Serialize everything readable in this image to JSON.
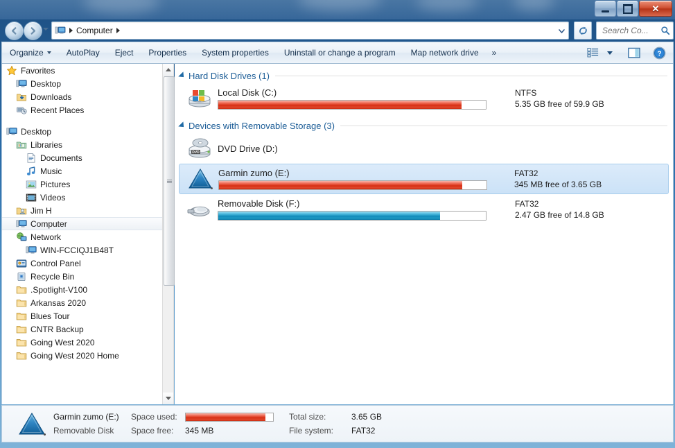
{
  "window": {
    "minimize_label": "Minimize",
    "maximize_label": "Maximize",
    "close_label": "Close"
  },
  "address_bar": {
    "crumb": "Computer",
    "separator": "▸",
    "dropdown_label": "Previous locations"
  },
  "search": {
    "placeholder": "Search Co...",
    "value": ""
  },
  "toolbar": {
    "organize": "Organize",
    "autoplay": "AutoPlay",
    "eject": "Eject",
    "properties": "Properties",
    "system_properties": "System properties",
    "uninstall": "Uninstall or change a program",
    "map_network_drive": "Map network drive",
    "overflow": "»",
    "views_label": "Change your view",
    "preview_label": "Show the preview pane",
    "help_label": "Help"
  },
  "sidebar": {
    "items": [
      {
        "label": "Favorites",
        "icon": "star-icon",
        "indent": 0,
        "selected": false
      },
      {
        "label": "Desktop",
        "icon": "desktop-icon",
        "indent": 1,
        "selected": false
      },
      {
        "label": "Downloads",
        "icon": "downloads-icon",
        "indent": 1,
        "selected": false
      },
      {
        "label": "Recent Places",
        "icon": "recent-icon",
        "indent": 1,
        "selected": false
      },
      {
        "label": "",
        "icon": "spacer",
        "indent": 0,
        "selected": false
      },
      {
        "label": "Desktop",
        "icon": "desktop-icon",
        "indent": 0,
        "selected": false
      },
      {
        "label": "Libraries",
        "icon": "library-icon",
        "indent": 1,
        "selected": false
      },
      {
        "label": "Documents",
        "icon": "document-icon",
        "indent": 2,
        "selected": false
      },
      {
        "label": "Music",
        "icon": "music-icon",
        "indent": 2,
        "selected": false
      },
      {
        "label": "Pictures",
        "icon": "picture-icon",
        "indent": 2,
        "selected": false
      },
      {
        "label": "Videos",
        "icon": "video-icon",
        "indent": 2,
        "selected": false
      },
      {
        "label": "Jim H",
        "icon": "user-icon",
        "indent": 1,
        "selected": false
      },
      {
        "label": "Computer",
        "icon": "computer-icon",
        "indent": 1,
        "selected": true
      },
      {
        "label": "Network",
        "icon": "network-icon",
        "indent": 1,
        "selected": false
      },
      {
        "label": "WIN-FCCIQJ1B48T",
        "icon": "computer-icon",
        "indent": 2,
        "selected": false
      },
      {
        "label": "Control Panel",
        "icon": "controlpanel-icon",
        "indent": 1,
        "selected": false
      },
      {
        "label": "Recycle Bin",
        "icon": "recyclebin-icon",
        "indent": 1,
        "selected": false
      },
      {
        "label": ".Spotlight-V100",
        "icon": "folder-icon",
        "indent": 1,
        "selected": false
      },
      {
        "label": "Arkansas 2020",
        "icon": "folder-icon",
        "indent": 1,
        "selected": false
      },
      {
        "label": "Blues Tour",
        "icon": "folder-icon",
        "indent": 1,
        "selected": false
      },
      {
        "label": "CNTR Backup",
        "icon": "folder-icon",
        "indent": 1,
        "selected": false
      },
      {
        "label": "Going West 2020",
        "icon": "folder-icon",
        "indent": 1,
        "selected": false
      },
      {
        "label": "Going West 2020 Home",
        "icon": "folder-icon",
        "indent": 1,
        "selected": false
      }
    ]
  },
  "content": {
    "groups": [
      {
        "title": "Hard Disk Drives (1)",
        "drives": [
          {
            "name": "Local Disk (C:)",
            "icon": "harddisk-icon",
            "filesystem": "NTFS",
            "capacity_line": "5.35 GB free of 59.9 GB",
            "bar": {
              "percent_used": 91,
              "color": "red"
            },
            "selected": false
          }
        ]
      },
      {
        "title": "Devices with Removable Storage (3)",
        "drives": [
          {
            "name": "DVD Drive (D:)",
            "icon": "dvd-icon",
            "filesystem": "",
            "capacity_line": "",
            "bar": null,
            "selected": false
          },
          {
            "name": "Garmin zumo (E:)",
            "icon": "garmin-icon",
            "filesystem": "FAT32",
            "capacity_line": "345 MB free of 3.65 GB",
            "bar": {
              "percent_used": 91,
              "color": "red"
            },
            "selected": true
          },
          {
            "name": "Removable Disk (F:)",
            "icon": "usb-icon",
            "filesystem": "FAT32",
            "capacity_line": "2.47 GB free of 14.8 GB",
            "bar": {
              "percent_used": 83,
              "color": "blue"
            },
            "selected": false
          }
        ]
      }
    ]
  },
  "details_pane": {
    "icon": "garmin-icon",
    "title": "Garmin zumo (E:)",
    "subtitle": "Removable Disk",
    "space_used_label": "Space used:",
    "space_free_label": "Space free:",
    "space_free_value": "345 MB",
    "total_size_label": "Total size:",
    "total_size_value": "3.65 GB",
    "file_system_label": "File system:",
    "file_system_value": "FAT32",
    "bar_percent_used": 91
  },
  "colors": {
    "accent_blue": "#1b5c96",
    "bar_red": "#d62d12",
    "bar_blue": "#1189b8",
    "selection": "#cbe2f7"
  }
}
